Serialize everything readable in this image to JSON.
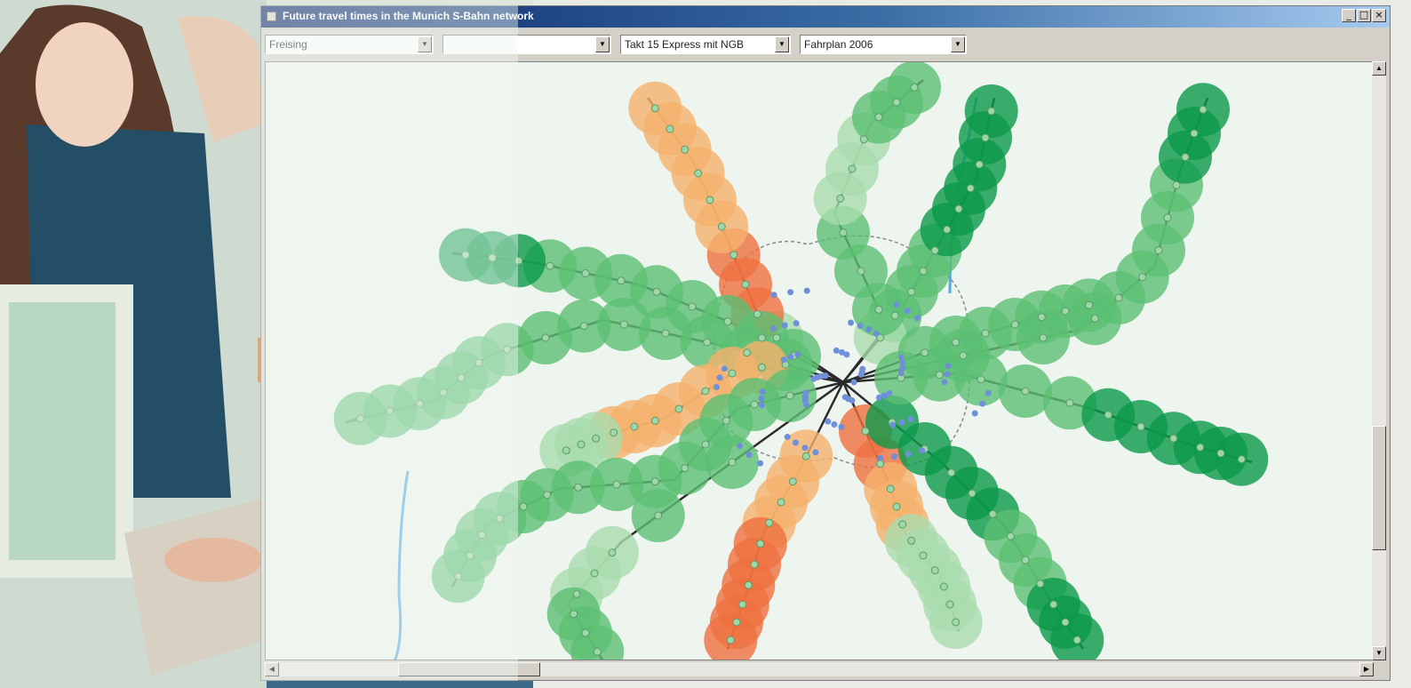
{
  "window": {
    "title": "Future travel times in the Munich S-Bahn network",
    "controls": {
      "minimize": "_",
      "maximize": "□",
      "close": "×"
    }
  },
  "toolbar": {
    "station_value": "Freising",
    "second_value": "",
    "service_value": "Takt 15 Express mit NGB",
    "timetable_value": "Fahrplan 2006"
  },
  "colors": {
    "near": "#0b9a4a",
    "mid": "#5bbf73",
    "light": "#a9dcae",
    "worse_light": "#f5b26b",
    "worse": "#ee7040",
    "inner_station": "#6f90d8",
    "river": "#5aa9e0"
  },
  "icons": {
    "app": "window-app-icon",
    "dropdown": "triangle-down-icon",
    "scroll_up": "triangle-up-icon",
    "scroll_down": "triangle-down-icon",
    "scroll_left": "triangle-left-icon",
    "scroll_right": "triangle-right-icon"
  }
}
